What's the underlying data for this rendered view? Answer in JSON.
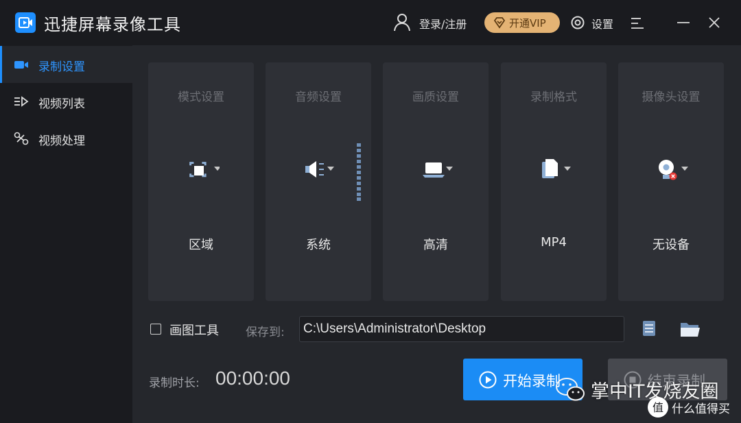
{
  "app": {
    "title": "迅捷屏幕录像工具",
    "login_label": "登录/注册",
    "vip_label": "开通VIP",
    "settings_label": "设置",
    "accent": "#1e8fff",
    "vip_color": "#e4b374"
  },
  "sidebar": {
    "items": [
      {
        "label": "录制设置",
        "icon": "video-camera-icon",
        "active": true
      },
      {
        "label": "视频列表",
        "icon": "video-list-icon",
        "active": false
      },
      {
        "label": "视频处理",
        "icon": "video-edit-icon",
        "active": false
      }
    ]
  },
  "cards": [
    {
      "title": "模式设置",
      "value": "区域",
      "icon": "region-select-icon"
    },
    {
      "title": "音频设置",
      "value": "系统",
      "icon": "speaker-icon"
    },
    {
      "title": "画质设置",
      "value": "高清",
      "icon": "laptop-icon"
    },
    {
      "title": "录制格式",
      "value": "MP4",
      "icon": "document-icon"
    },
    {
      "title": "摄像头设置",
      "value": "无设备",
      "icon": "webcam-disabled-icon"
    }
  ],
  "draw_tool": {
    "label": "画图工具",
    "checked": false
  },
  "save": {
    "label": "保存到:",
    "path": "C:\\Users\\Administrator\\Desktop"
  },
  "duration": {
    "label": "录制时长:",
    "value": "00:00:00"
  },
  "buttons": {
    "start": "开始录制",
    "stop": "结束录制"
  },
  "watermark": {
    "text": "掌中IT发烧友圈",
    "site_logo": "值",
    "site": "什么值得买"
  }
}
